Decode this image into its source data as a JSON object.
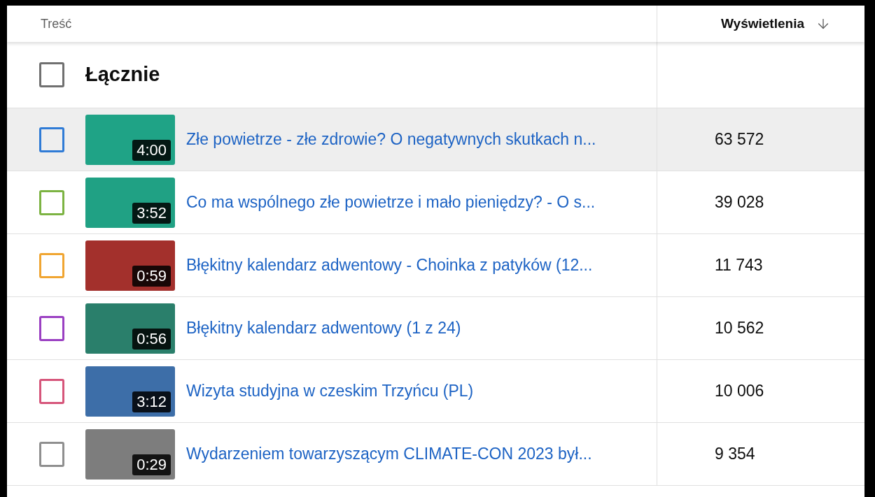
{
  "table": {
    "columns": [
      {
        "label": "Treść",
        "sorted": false
      },
      {
        "label": "Wyświetlenia",
        "sorted": true
      }
    ],
    "total": {
      "label": "Łącznie",
      "checked": false
    },
    "rows": [
      {
        "title": "Złe powietrze - złe zdrowie? O negatywnych skutkach n...",
        "duration": "4:00",
        "views": "63 572",
        "color": "#2f7bd6",
        "checked": false,
        "hovered": true
      },
      {
        "title": "Co ma wspólnego złe powietrze i mało pieniędzy? - O s...",
        "duration": "3:52",
        "views": "39 028",
        "color": "#7cb342",
        "checked": false,
        "hovered": false
      },
      {
        "title": "Błękitny kalendarz adwentowy - Choinka z patyków (12...",
        "duration": "0:59",
        "views": "11 743",
        "color": "#f0a531",
        "checked": false,
        "hovered": false
      },
      {
        "title": "Błękitny kalendarz adwentowy (1 z 24)",
        "duration": "0:56",
        "views": "10 562",
        "color": "#9a3fc2",
        "checked": false,
        "hovered": false
      },
      {
        "title": "Wizyta studyjna w czeskim Trzyńcu (PL)",
        "duration": "3:12",
        "views": "10 006",
        "color": "#d6557a",
        "checked": false,
        "hovered": false
      },
      {
        "title": "Wydarzeniem towarzyszącym CLIMATE-CON 2023 był...",
        "duration": "0:29",
        "views": "9 354",
        "color": "#8f8f8f",
        "checked": false,
        "hovered": false
      }
    ]
  }
}
